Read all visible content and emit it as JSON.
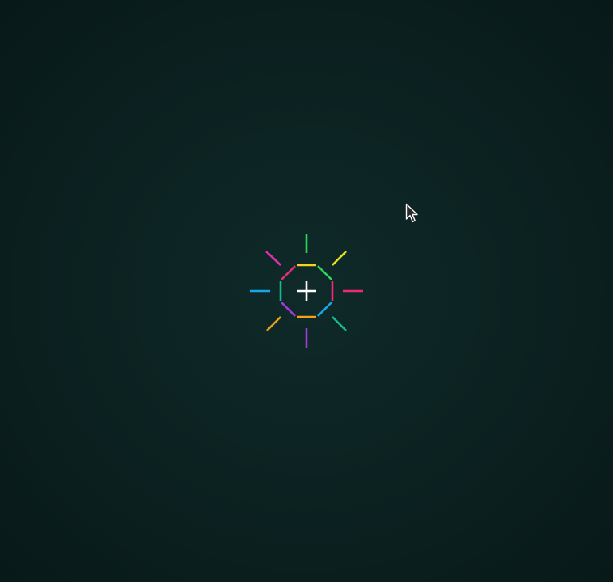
{
  "app": {
    "background_color": "#0b2120"
  },
  "center_button": {
    "icon": "plus-icon",
    "plus_color": "#ffffff"
  },
  "burst_icon": {
    "icon": "rainbow-sunburst-icon",
    "ray_colors": {
      "north": "#2ed35a",
      "north_east": "#e2e01f",
      "east": "#f0287a",
      "south_east": "#18b894",
      "south": "#a23ad8",
      "south_west": "#e3a11c",
      "west": "#18a6e6",
      "north_west": "#e02eb0"
    },
    "ring_colors": [
      "#f5d21c",
      "#2ed35a",
      "#f0287a",
      "#18a6e6",
      "#f5a01c",
      "#a23ad8",
      "#18b894",
      "#e0307a"
    ]
  },
  "pointer": {
    "icon": "mouse-pointer-icon",
    "fill": "#2a2a2a",
    "stroke": "#ffffff"
  }
}
